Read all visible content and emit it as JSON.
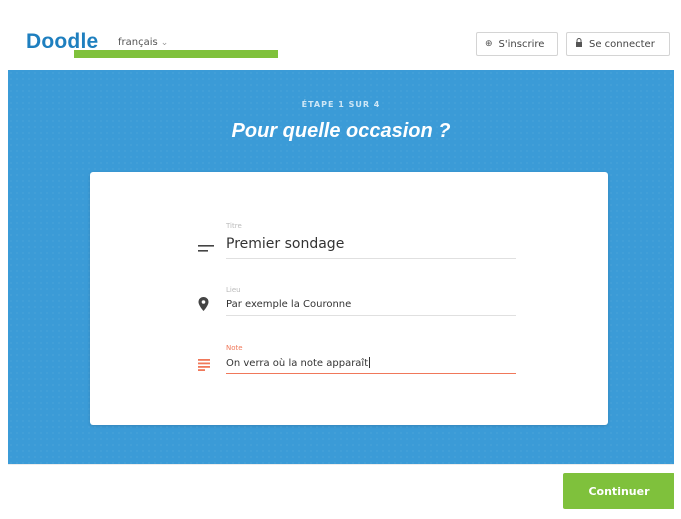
{
  "header": {
    "logo": "Doodle",
    "language": "français",
    "signup_label": "S'inscrire",
    "login_label": "Se connecter"
  },
  "hero": {
    "step": "ÉTAPE 1 SUR 4",
    "question": "Pour quelle occasion ?"
  },
  "form": {
    "title": {
      "label": "Titre",
      "value": "Premier sondage"
    },
    "where": {
      "label": "Lieu",
      "placeholder": "Par exemple la Couronne"
    },
    "note": {
      "label": "Note",
      "value": "On verra où la note apparaît"
    }
  },
  "footer": {
    "continue_label": "Continuer",
    "progress_fraction": 0.25
  },
  "colors": {
    "brand_blue": "#3b9bd7",
    "logo_blue": "#1e7fbf",
    "accent_green": "#7fc13c",
    "note_orange": "#f0785a"
  },
  "icons": [
    "chevron-down-icon",
    "globe-icon",
    "lock-icon",
    "title-lines-icon",
    "location-pin-icon",
    "note-lines-icon"
  ]
}
